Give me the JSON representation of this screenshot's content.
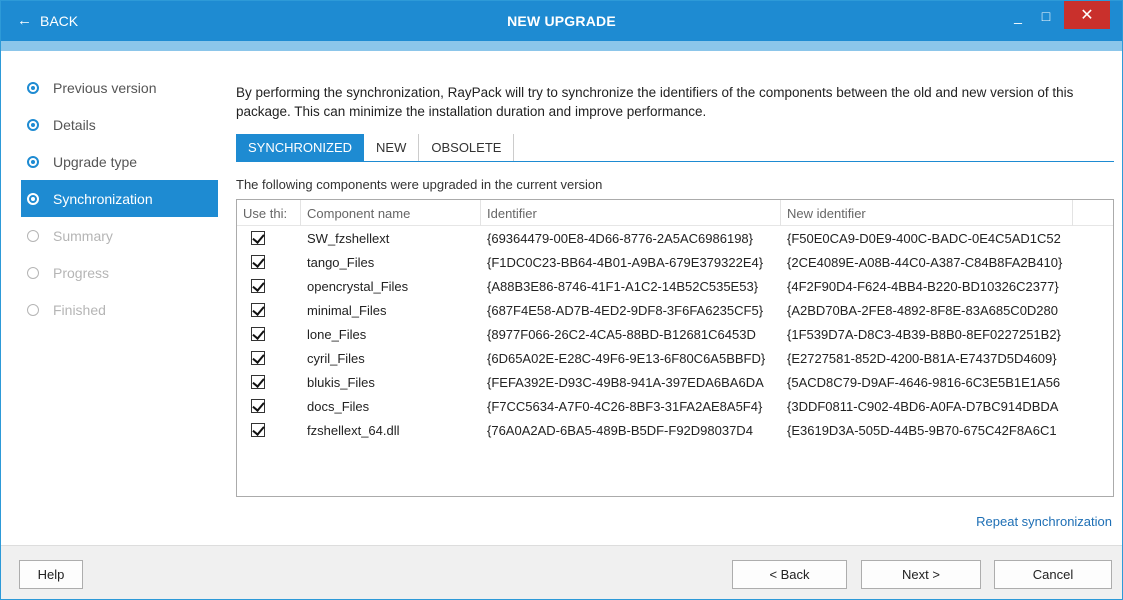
{
  "titlebar": {
    "back_label": "BACK",
    "title": "NEW UPGRADE",
    "minimize": "_",
    "maximize": "□",
    "close": "✕"
  },
  "sidebar": {
    "steps": [
      {
        "label": "Previous version",
        "state": "done"
      },
      {
        "label": "Details",
        "state": "done"
      },
      {
        "label": "Upgrade type",
        "state": "done"
      },
      {
        "label": "Synchronization",
        "state": "active"
      },
      {
        "label": "Summary",
        "state": "disabled"
      },
      {
        "label": "Progress",
        "state": "disabled"
      },
      {
        "label": "Finished",
        "state": "disabled"
      }
    ]
  },
  "main": {
    "description": "By performing the synchronization, RayPack will try to synchronize the identifiers of the components between the old and new version of this package. This can minimize the installation duration and improve performance.",
    "tabs": [
      {
        "label": "SYNCHRONIZED",
        "active": true
      },
      {
        "label": "NEW",
        "active": false
      },
      {
        "label": "OBSOLETE",
        "active": false
      }
    ],
    "caption": "The following components were upgraded in the current version",
    "grid": {
      "headers": [
        "Use thi:",
        "Component name",
        "Identifier",
        "New identifier"
      ],
      "rows": [
        {
          "checked": true,
          "name": "SW_fzshellext",
          "identifier": "{69364479-00E8-4D66-8776-2A5AC6986198}",
          "new_identifier": "{F50E0CA9-D0E9-400C-BADC-0E4C5AD1C52"
        },
        {
          "checked": true,
          "name": "tango_Files",
          "identifier": "{F1DC0C23-BB64-4B01-A9BA-679E379322E4}",
          "new_identifier": "{2CE4089E-A08B-44C0-A387-C84B8FA2B410}"
        },
        {
          "checked": true,
          "name": "opencrystal_Files",
          "identifier": "{A88B3E86-8746-41F1-A1C2-14B52C535E53}",
          "new_identifier": "{4F2F90D4-F624-4BB4-B220-BD10326C2377}"
        },
        {
          "checked": true,
          "name": "minimal_Files",
          "identifier": "{687F4E58-AD7B-4ED2-9DF8-3F6FA6235CF5}",
          "new_identifier": "{A2BD70BA-2FE8-4892-8F8E-83A685C0D280"
        },
        {
          "checked": true,
          "name": "lone_Files",
          "identifier": "{8977F066-26C2-4CA5-88BD-B12681C6453D",
          "new_identifier": "{1F539D7A-D8C3-4B39-B8B0-8EF0227251B2}"
        },
        {
          "checked": true,
          "name": "cyril_Files",
          "identifier": "{6D65A02E-E28C-49F6-9E13-6F80C6A5BBFD}",
          "new_identifier": "{E2727581-852D-4200-B81A-E7437D5D4609}"
        },
        {
          "checked": true,
          "name": "blukis_Files",
          "identifier": "{FEFA392E-D93C-49B8-941A-397EDA6BA6DA",
          "new_identifier": "{5ACD8C79-D9AF-4646-9816-6C3E5B1E1A56"
        },
        {
          "checked": true,
          "name": "docs_Files",
          "identifier": "{F7CC5634-A7F0-4C26-8BF3-31FA2AE8A5F4}",
          "new_identifier": "{3DDF0811-C902-4BD6-A0FA-D7BC914DBDA"
        },
        {
          "checked": true,
          "name": "fzshellext_64.dll",
          "identifier": "{76A0A2AD-6BA5-489B-B5DF-F92D98037D4",
          "new_identifier": "{E3619D3A-505D-44B5-9B70-675C42F8A6C1"
        }
      ]
    },
    "repeat_link": "Repeat synchronization"
  },
  "footer": {
    "help": "Help",
    "back": "< Back",
    "next": "Next >",
    "cancel": "Cancel"
  },
  "colors": {
    "accent": "#1e8bd2",
    "close": "#c9302c",
    "link": "#1e6fb5"
  }
}
